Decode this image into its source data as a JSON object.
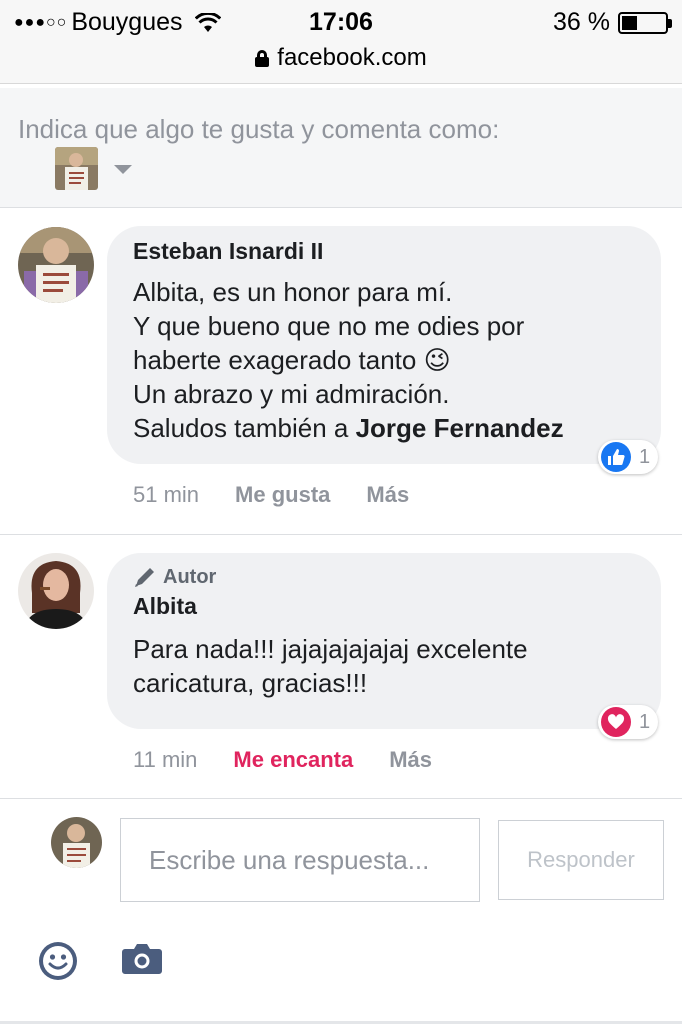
{
  "status_bar": {
    "signal": "●●●○○",
    "carrier": "Bouygues",
    "time": "17:06",
    "battery": "36 %",
    "battery_level": 0.36
  },
  "url_bar": {
    "domain": "facebook.com",
    "secure": true
  },
  "like_as": {
    "text": "Indica que algo te gusta y comenta como:"
  },
  "comments": [
    {
      "author": "Esteban Isnardi II",
      "body_lines": [
        "Albita, es un honor para mí.",
        "Y que bueno que no me odies por",
        "haberte exagerado tanto"
      ],
      "emoji": "😉",
      "body_lines_2": [
        "Un abrazo y mi admiración.",
        "Saludos también a "
      ],
      "mention": "Jorge Fernandez",
      "reaction": {
        "type": "like",
        "count": "1",
        "color": "#1877f2"
      },
      "time": "51 min",
      "action_like": "Me gusta",
      "action_more": "Más"
    },
    {
      "badge": "Autor",
      "author": "Albita",
      "body_lines": [
        "Para nada!!! jajajajajajaj excelente",
        "caricatura, gracias!!!"
      ],
      "reaction": {
        "type": "love",
        "count": "1",
        "color": "#e0245e"
      },
      "time": "11 min",
      "action_like": "Me encanta",
      "action_more": "Más"
    }
  ],
  "composer": {
    "placeholder": "Escribe una respuesta...",
    "button": "Responder"
  },
  "toolbar": {
    "icons": [
      "emoji-icon",
      "camera-icon"
    ]
  }
}
